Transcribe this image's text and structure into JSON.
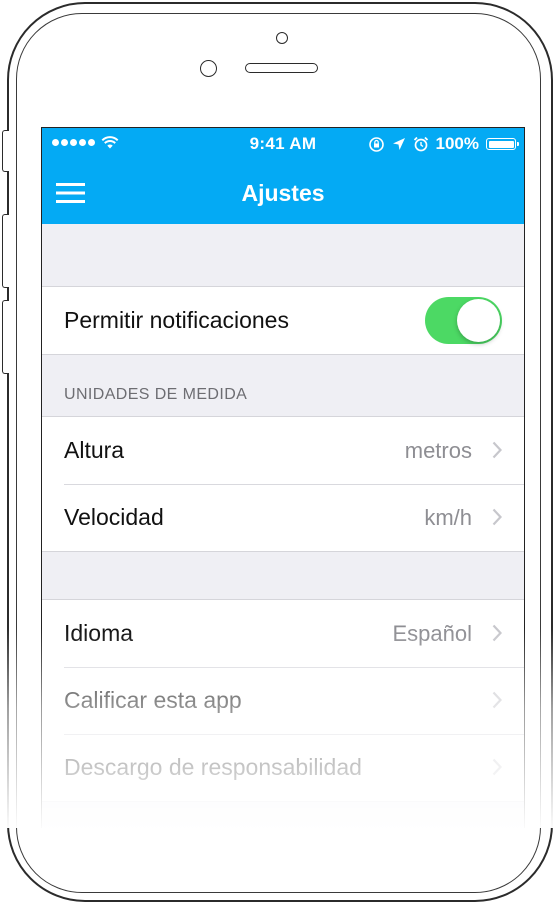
{
  "status_bar": {
    "time": "9:41 AM",
    "battery_percent": "100%",
    "signal_dots": 5,
    "icons": [
      "wifi-icon",
      "screen-rotation-lock-icon",
      "location-arrow-icon",
      "alarm-clock-icon",
      "battery-icon"
    ]
  },
  "nav": {
    "title": "Ajustes",
    "menu_icon": "hamburger-menu-icon"
  },
  "notifications": {
    "label": "Permitir notificaciones",
    "enabled": true
  },
  "units_section": {
    "header": "UNIDADES DE MEDIDA",
    "rows": [
      {
        "label": "Altura",
        "value": "metros"
      },
      {
        "label": "Velocidad",
        "value": "km/h"
      }
    ]
  },
  "general_section": {
    "rows": [
      {
        "label": "Idioma",
        "value": "Español"
      },
      {
        "label": "Calificar esta app",
        "value": ""
      },
      {
        "label": "Descargo de responsabilidad",
        "value": ""
      }
    ]
  },
  "colors": {
    "accent": "#04aaf4",
    "toggle_on": "#4cd964",
    "background": "#efeff4"
  }
}
